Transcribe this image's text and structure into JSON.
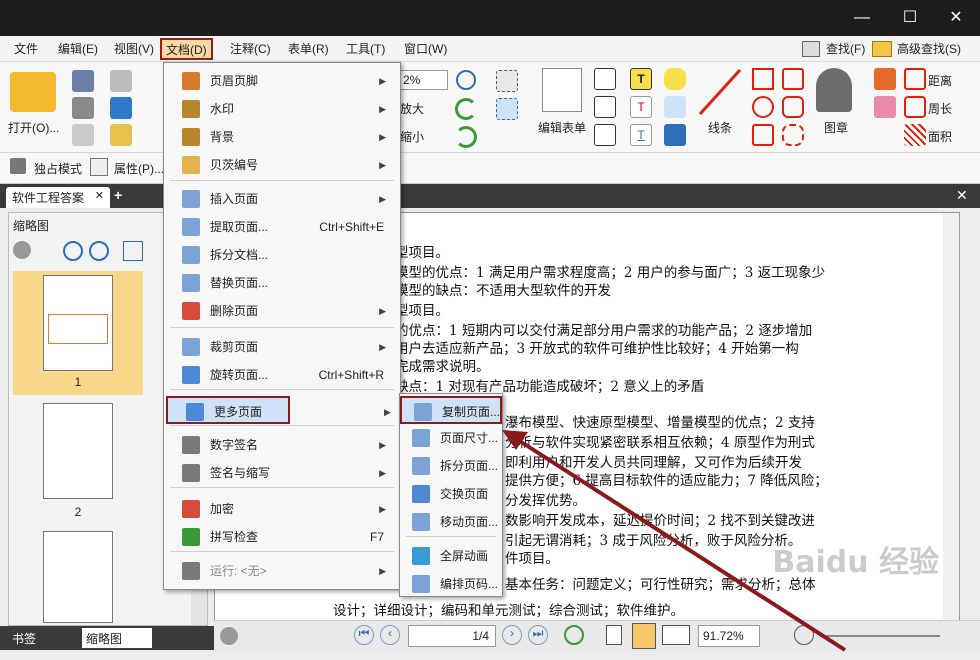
{
  "window": {
    "minimize": "—",
    "maximize": "☐",
    "close": "✕"
  },
  "menubar": {
    "items": [
      "文件",
      "编辑(E)",
      "视图(V)",
      "文档(D)",
      "注释(C)",
      "表单(R)",
      "工具(T)",
      "窗口(W)"
    ],
    "find": "查找(F)",
    "advanced_find": "高级查找(S)"
  },
  "ribbon": {
    "open": "打开(O)...",
    "zoom_value": "2%",
    "zoom_in": "放大",
    "zoom_out": "缩小",
    "edit_form": "编辑表单",
    "line": "线条",
    "stamp": "图章",
    "distance": "距离",
    "perimeter": "周长",
    "area": "面积",
    "exclusive_mode": "独占模式",
    "properties": "属性(P)..."
  },
  "doc_tab": {
    "name": "软件工程答案",
    "close": "✕"
  },
  "left_panel": {
    "title": "缩略图",
    "pages": [
      "1",
      "2"
    ],
    "tabs": [
      "书签",
      "缩略图"
    ]
  },
  "document": {
    "lines": [
      "型项目。",
      "模型的优点：1 满足用户需求程度高；2 用户的参与面广；3 返工现象少",
      "模型的缺点：不适用大型软件的开发",
      "型项目。",
      "的优点：1 短期内可以交付满足部分用户需求的功能产品；2 逐步增加",
      "用户去适应新产品；3 开放式的软件可维护性比较好；4 开始第一构",
      "完成需求说明。",
      "缺点：1 对现有产品功能造成破坏；2 意义上的矛盾",
      "瀑布模型、快速原型模型、增量模型的优点；2 支持",
      "分析与软件实现紧密联系相互依赖；4 原型作为刑式",
      "即利用户和开发人员共同理解，又可作为后续开发",
      "提供方便；6 提高目标软件的适应能力；7 降低风险；",
      "分发挥优势。",
      "数影响开发成本，延迟提价时间；2 找不到关键改进",
      "引起无谓消耗；3 成于风险分析，败于风险分析。",
      "件项目。",
      "基本任务：问题定义；可行性研究；需求分析；总体",
      "设计；详细设计；编码和单元测试；综合测试；软件维护。"
    ]
  },
  "statusbar": {
    "page": "1/4",
    "zoom": "91.72%"
  },
  "doc_menu": {
    "items": [
      {
        "label": "页眉页脚",
        "shortcut": "",
        "arrow": "▶"
      },
      {
        "label": "水印",
        "shortcut": "",
        "arrow": "▶"
      },
      {
        "label": "背景",
        "shortcut": "",
        "arrow": "▶"
      },
      {
        "label": "贝茨编号",
        "shortcut": "",
        "arrow": "▶"
      },
      {
        "label": "插入页面",
        "shortcut": "",
        "arrow": "▶"
      },
      {
        "label": "提取页面...",
        "shortcut": "Ctrl+Shift+E",
        "arrow": ""
      },
      {
        "label": "拆分文档...",
        "shortcut": "",
        "arrow": ""
      },
      {
        "label": "替换页面...",
        "shortcut": "",
        "arrow": ""
      },
      {
        "label": "删除页面",
        "shortcut": "",
        "arrow": "▶"
      },
      {
        "label": "裁剪页面",
        "shortcut": "",
        "arrow": "▶"
      },
      {
        "label": "旋转页面...",
        "shortcut": "Ctrl+Shift+R",
        "arrow": ""
      },
      {
        "label": "更多页面",
        "shortcut": "",
        "arrow": "▶"
      },
      {
        "label": "数字签名",
        "shortcut": "",
        "arrow": "▶"
      },
      {
        "label": "签名与缩写",
        "shortcut": "",
        "arrow": "▶"
      },
      {
        "label": "加密",
        "shortcut": "",
        "arrow": "▶"
      },
      {
        "label": "拼写检查",
        "shortcut": "F7",
        "arrow": ""
      },
      {
        "label": "运行: <无>",
        "shortcut": "",
        "arrow": "▶"
      }
    ]
  },
  "sub_menu": {
    "items": [
      "复制页面...",
      "页面尺寸...",
      "拆分页面...",
      "交换页面",
      "移动页面...",
      "全屏动画",
      "编排页码..."
    ]
  },
  "watermark": "Baidu 经验",
  "colors": {
    "highlight_border": "#8b1a1a",
    "arrow": "#8b1a1a"
  }
}
